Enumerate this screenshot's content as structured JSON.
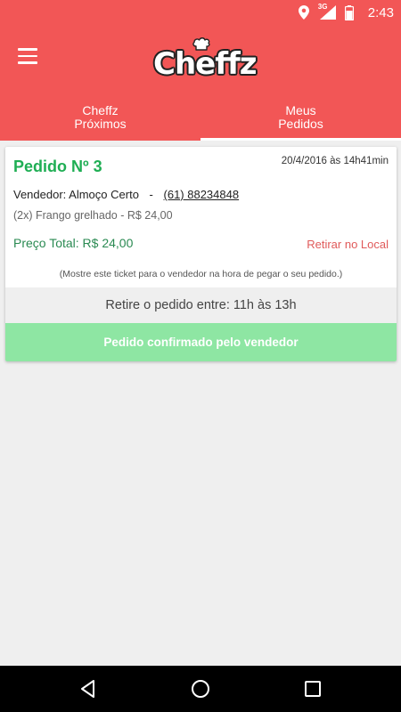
{
  "status_bar": {
    "network_label": "3G",
    "time": "2:43",
    "icons": [
      "location-icon",
      "signal-icon",
      "battery-icon"
    ]
  },
  "app_bar": {
    "menu_icon": "hamburger-menu-icon",
    "logo_text": "Cheffz",
    "logo_icon": "chef-hat-icon"
  },
  "tabs": [
    {
      "line1": "Cheffz",
      "line2": "Próximos",
      "active": false
    },
    {
      "line1": "Meus",
      "line2": "Pedidos",
      "active": true
    }
  ],
  "order": {
    "title": "Pedido Nº 3",
    "date": "20/4/2016 às 14h41min",
    "vendor_label": "Vendedor: Almoço Certo",
    "separator": "-",
    "vendor_phone": "(61) 88234848",
    "item_line": "(2x) Frango grelhado - R$ 24,00",
    "total": "Preço Total: R$ 24,00",
    "pickup_type": "Retirar no Local",
    "note": "(Mostre este ticket para o vendedor na hora de pegar o seu pedido.)",
    "pickup_window": "Retire o pedido entre: 11h às 13h",
    "status": "Pedido confirmado pelo vendedor"
  },
  "colors": {
    "brand_red": "#f25656",
    "title_green": "#1fae54",
    "confirmed_green": "#8ee6a3",
    "pickup_red": "#e05a5a"
  },
  "nav_bar": {
    "icons": [
      "back-icon",
      "home-icon",
      "recents-icon"
    ]
  }
}
